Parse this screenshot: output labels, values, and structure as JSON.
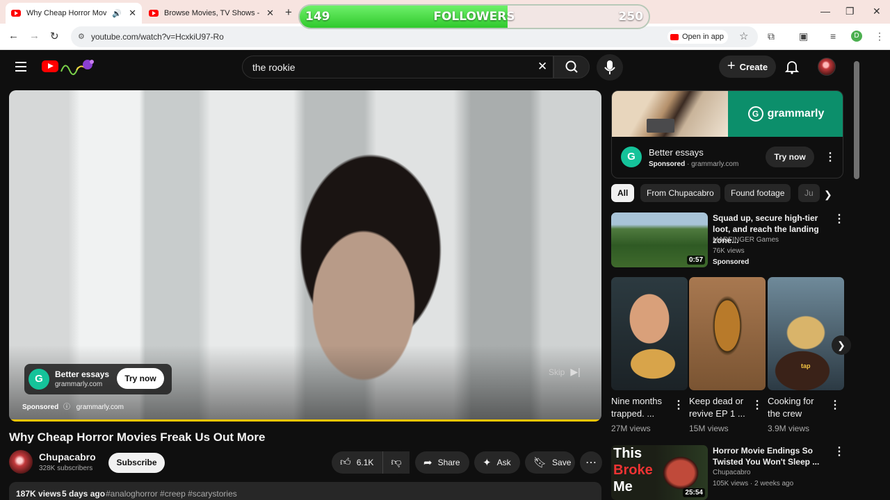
{
  "browser": {
    "tabs": [
      {
        "title": "Why Cheap Horror Movies F",
        "active": true
      },
      {
        "title": "Browse Movies, TV Shows - yFl",
        "active": false
      }
    ],
    "new_tab": "+",
    "window_controls": {
      "minimize": "—",
      "restore": "❐",
      "close": "✕"
    },
    "url": "youtube.com/watch?v=HcxkiU97-Ro",
    "open_in_app": "Open in app",
    "profile_initial": "D"
  },
  "followers_overlay": {
    "current": "149",
    "label": "FOLLOWERS",
    "goal": "250",
    "fill_fraction": 0.596
  },
  "masthead": {
    "search_query": "the rookie",
    "create_label": "Create"
  },
  "player": {
    "ad_title": "Better essays",
    "ad_domain": "grammarly.com",
    "ad_cta": "Try now",
    "sponsored": "Sponsored",
    "sponsored_domain": "grammarly.com",
    "skip_label": "Skip"
  },
  "video": {
    "title": "Why Cheap Horror Movies Freak Us Out More",
    "channel": "Chupacabro",
    "subscribers": "328K subscribers",
    "subscribe_label": "Subscribe",
    "likes": "6.1K",
    "share_label": "Share",
    "ask_label": "Ask",
    "save_label": "Save",
    "views": "187K views",
    "date": "5 days ago",
    "tags": "#analoghorror #creep #scarystories"
  },
  "sidebar_ad": {
    "brand": "grammarly",
    "title": "Better essays",
    "sponsored": "Sponsored",
    "domain": "grammarly.com",
    "cta": "Try now"
  },
  "chips": [
    "All",
    "From Chupacabro",
    "Found footage",
    "Ju"
  ],
  "recommendations": [
    {
      "title": "Squad up, secure high-tier loot, and reach the landing zone...",
      "channel": "MADFINGER Games",
      "meta": "76K views",
      "sponsored": "Sponsored",
      "duration": "0:57"
    },
    {
      "title": "Horror Movie Endings So Twisted You Won't Sleep ...",
      "channel": "Chupacabro",
      "meta": "105K views · 2 weeks ago",
      "duration": "25:54",
      "thumb_text": [
        "This",
        "Broke",
        "Me"
      ]
    }
  ],
  "shorts": [
    {
      "title": "Nine months trapped. ...",
      "views": "27M views"
    },
    {
      "title": "Keep dead or revive EP 1 ...",
      "views": "15M views"
    },
    {
      "title": "Cooking for the crew",
      "views": "3.9M views",
      "thumb_text": "tap"
    }
  ]
}
